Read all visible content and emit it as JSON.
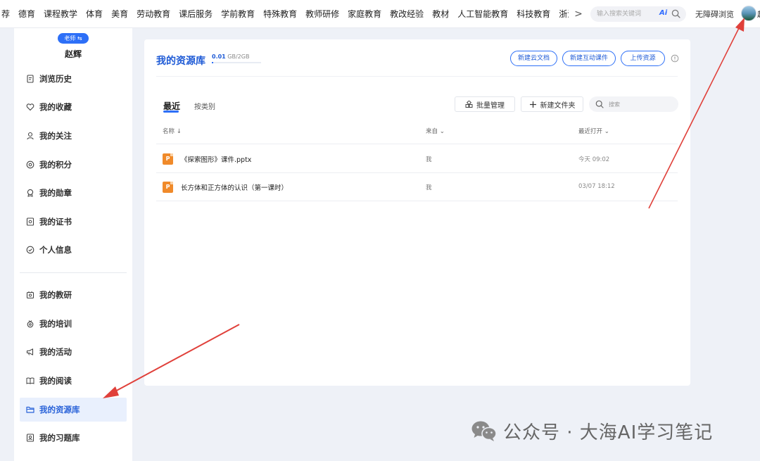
{
  "top_nav": {
    "items": [
      "荐",
      "德育",
      "课程教学",
      "体育",
      "美育",
      "劳动教育",
      "课后服务",
      "学前教育",
      "特殊教育",
      "教师研修",
      "家庭教育",
      "教改经验",
      "教材",
      "人工智能教育",
      "科技教育",
      "浙江缘"
    ],
    "more_glyph": ">",
    "search_placeholder": "输入搜索关键词",
    "ai_label": "Ai",
    "accessibility_label": "无障碍浏览",
    "avatar_edge_text": "赵"
  },
  "sidebar": {
    "role_badge": "老师 ⇆",
    "user_name": "赵辉",
    "items": [
      {
        "label": "浏览历史",
        "icon": "history-icon"
      },
      {
        "label": "我的收藏",
        "icon": "heart-icon"
      },
      {
        "label": "我的关注",
        "icon": "user-icon"
      },
      {
        "label": "我的积分",
        "icon": "points-icon"
      },
      {
        "label": "我的勋章",
        "icon": "medal-icon"
      },
      {
        "label": "我的证书",
        "icon": "certificate-icon"
      },
      {
        "label": "个人信息",
        "icon": "check-circle-icon"
      },
      {
        "label": "我的教研",
        "icon": "research-icon"
      },
      {
        "label": "我的培训",
        "icon": "training-icon"
      },
      {
        "label": "我的活动",
        "icon": "megaphone-icon"
      },
      {
        "label": "我的阅读",
        "icon": "book-icon"
      },
      {
        "label": "我的资源库",
        "icon": "folder-icon",
        "active": true
      },
      {
        "label": "我的习题库",
        "icon": "exercise-icon"
      }
    ]
  },
  "main": {
    "title": "我的资源库",
    "storage_used": "0.01",
    "storage_total": "GB/2GB",
    "storage_fraction": 0.005,
    "buttons": {
      "new_doc": "新建云文档",
      "new_interactive": "新建互动课件",
      "upload": "上传资源"
    },
    "tabs": {
      "recent": "最近",
      "by_category": "按类别"
    },
    "toolbar": {
      "batch_manage": "批量管理",
      "new_folder": "新建文件夹",
      "search_placeholder": "搜索"
    },
    "columns": {
      "name": "名称 ↓",
      "from": "来自 ⌄",
      "last_opened": "最近打开 ⌄"
    },
    "files": [
      {
        "name": "《探索图形》课件.pptx",
        "from": "我",
        "time": "今天 09:02",
        "type_glyph": "P"
      },
      {
        "name": "长方体和正方体的认识（第一课时）",
        "from": "我",
        "time": "03/07 18:12",
        "type_glyph": "P"
      }
    ]
  },
  "watermark": {
    "text": "公众号 · 大海AI学习笔记"
  },
  "colors": {
    "accent": "#2d6ff7",
    "arrow": "#e0403a",
    "file_icon": "#f08a2a"
  }
}
